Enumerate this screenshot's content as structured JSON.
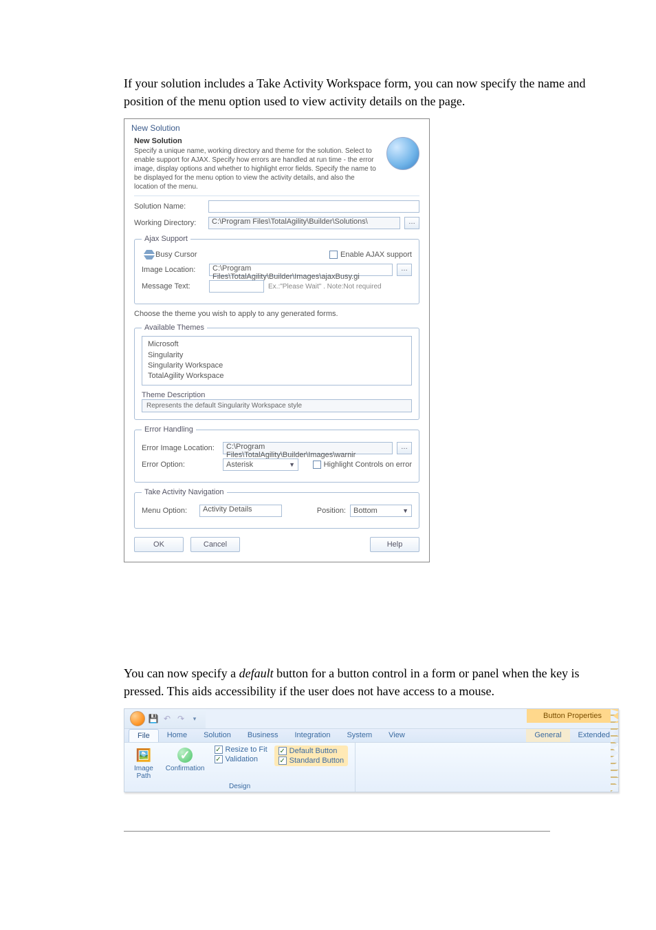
{
  "doc": {
    "p1": "If your solution includes a Take Activity Workspace form, you can now specify the name and position of the menu option used to view activity details on the page.",
    "p2a": "You can now specify a ",
    "p2b": "default",
    "p2c": " button for a button control in a form or panel when the ",
    "p2d": " key is pressed. This aids accessibility if the user does not have access to a mouse."
  },
  "dialog": {
    "title": "New Solution",
    "headerTitle": "New Solution",
    "headerDesc": "Specify a unique name, working directory and theme for the solution. Select to enable support for AJAX. Specify how errors are handled at run time - the error image, display options and whether to highlight error fields. Specify the name to be displayed for the menu option to view the activity details, and also the location of the menu.",
    "solutionNameLabel": "Solution Name:",
    "workingDirLabel": "Working Directory:",
    "workingDirValue": "C:\\Program Files\\TotalAgility\\Builder\\Solutions\\",
    "ajaxLegend": "Ajax Support",
    "busyCursorLabel": "Busy Cursor",
    "enableAjaxLabel": "Enable AJAX support",
    "imageLocLabel": "Image Location:",
    "imageLocValue": "C:\\Program Files\\TotalAgility\\Builder\\Images\\ajaxBusy.gi",
    "messageTextLabel": "Message Text:",
    "messageTextHint": "Ex.:\"Please Wait\" .  Note:Not required",
    "chooseTheme": "Choose the theme you wish to apply to any generated forms.",
    "availableThemesLabel": "Available Themes",
    "themes": [
      "Microsoft",
      "Singularity",
      "Singularity Workspace",
      "TotalAgility Workspace"
    ],
    "themeDescLabel": "Theme Description",
    "themeDescValue": "Represents the default Singularity Workspace style",
    "errHandlingLegend": "Error Handling",
    "errImgLocLabel": "Error Image Location:",
    "errImgLocValue": "C:\\Program Files\\TotalAgility\\Builder\\Images\\warnir",
    "errOptionLabel": "Error Option:",
    "errOptionValue": "Asterisk",
    "highlightLabel": "Highlight Controls on error",
    "takeActivityLegend": "Take Activity Navigation",
    "menuOptionLabel": "Menu Option:",
    "menuOptionValue": "Activity Details",
    "positionLabel": "Position:",
    "positionValue": "Bottom",
    "ok": "OK",
    "cancel": "Cancel",
    "help": "Help"
  },
  "ribbon": {
    "titleTabs": {
      "active": "Button Properties",
      "general": "General",
      "ext": "Extended"
    },
    "tabs": [
      "File",
      "Home",
      "Solution",
      "Business",
      "Integration",
      "System",
      "View"
    ],
    "activeTab": "File",
    "group1": {
      "imagePathLabel": "Image\nPath",
      "confirmationLabel": "Confirmation"
    },
    "chkA": {
      "resize": "Resize to Fit",
      "validation": "Validation"
    },
    "chkB": {
      "default": "Default Button",
      "standard": "Standard Button"
    },
    "designLabel": "Design"
  }
}
